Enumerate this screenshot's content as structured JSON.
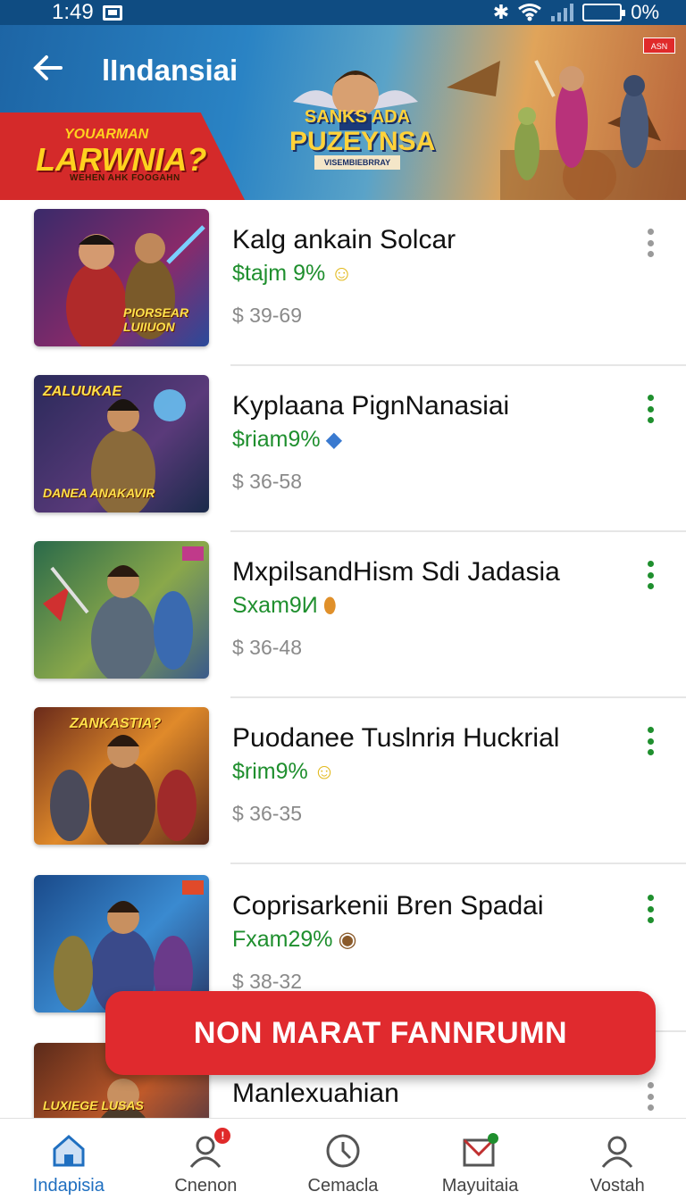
{
  "status": {
    "time": "1:49",
    "battery": "0%"
  },
  "header": {
    "title": "lIndansiai",
    "back_label": "←"
  },
  "banner": {
    "promo_title": "LARWNIA?",
    "promo_pre": "YOUARMAN",
    "promo_sub": "WEHEN AHK FOOGAHN",
    "logo_line1": "SANKS ADA",
    "logo_line2": "PUZEYNSA",
    "logo_tag": "VISEMBIEBRRAY",
    "corner_badge": "ASN"
  },
  "items": [
    {
      "title": "Kalg ankain Solcar",
      "rate": "$tajm 9%",
      "emoji": "☺",
      "price": "$ 39-69",
      "thumb_label": "PIORSEAR LUIIUON",
      "thumb_top": "",
      "menu_color": "#9a9a9a"
    },
    {
      "title": "Kyplaana PignNanasiai",
      "rate": "$riam9%",
      "emoji": "◆",
      "price": "$ 36-58",
      "thumb_label": "DANEA ANAKAVIR",
      "thumb_top": "ZALUUKAE",
      "menu_color": "#1f8f2e"
    },
    {
      "title": "MxpilsandHism Sdi Jadasia",
      "rate": "Sxam9И",
      "emoji": "⬮",
      "price": "$ 36-48",
      "thumb_label": "",
      "thumb_top": "",
      "menu_color": "#1f8f2e"
    },
    {
      "title": "Puodanee Tuslnriя Huckrial",
      "rate": "$rim9%",
      "emoji": "☺",
      "price": "$ 36-35",
      "thumb_label": "",
      "thumb_top": "ZANKASTIA?",
      "menu_color": "#1f8f2e"
    },
    {
      "title": "Coprisarkenii Bren Spadai",
      "rate": "Fxam29%",
      "emoji": "◉",
      "price": "$ 38-32",
      "thumb_label": "",
      "thumb_top": "",
      "menu_color": "#1f8f2e"
    },
    {
      "title": "Manlexuahian",
      "rate": "",
      "emoji": "",
      "price": "",
      "thumb_label": "LUXIEGE LUSAS",
      "thumb_top": "",
      "menu_color": "#9a9a9a"
    }
  ],
  "cta": {
    "label": "NON MARAT FANNRUMN"
  },
  "nav": [
    {
      "label": "Indapisia",
      "icon": "home-icon",
      "active": true
    },
    {
      "label": "Cnenon",
      "icon": "profile-icon",
      "badge": "!"
    },
    {
      "label": "Cemacla",
      "icon": "clock-icon"
    },
    {
      "label": "Mayuitaia",
      "icon": "map-icon"
    },
    {
      "label": "Vostah",
      "icon": "user-icon"
    }
  ],
  "colors": {
    "accent": "#1f6fc0",
    "green": "#1f8f2e",
    "cta": "#e02a2e",
    "header": "#0f4c82"
  }
}
